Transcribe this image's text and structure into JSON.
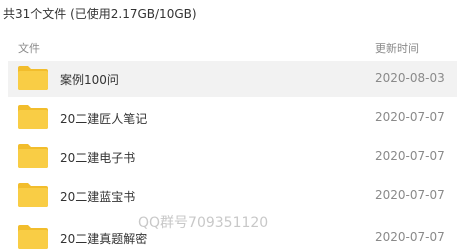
{
  "summary": "共31个文件 (已使用2.17GB/10GB)",
  "header": {
    "file_label": "文件",
    "time_label": "更新时间"
  },
  "files": [
    {
      "name": "案例100问",
      "date": "2020-08-03"
    },
    {
      "name": "20二建匠人笔记",
      "date": "2020-07-07"
    },
    {
      "name": "20二建电子书",
      "date": "2020-07-07"
    },
    {
      "name": "20二建蓝宝书",
      "date": "2020-07-07"
    },
    {
      "name": "20二建真题解密",
      "date": "2020-07-07"
    }
  ],
  "watermark": "QQ群号709351120",
  "colors": {
    "folder": "#f9cd45",
    "folder_tab": "#f2bd2c",
    "highlight": "#f2f2f2"
  }
}
